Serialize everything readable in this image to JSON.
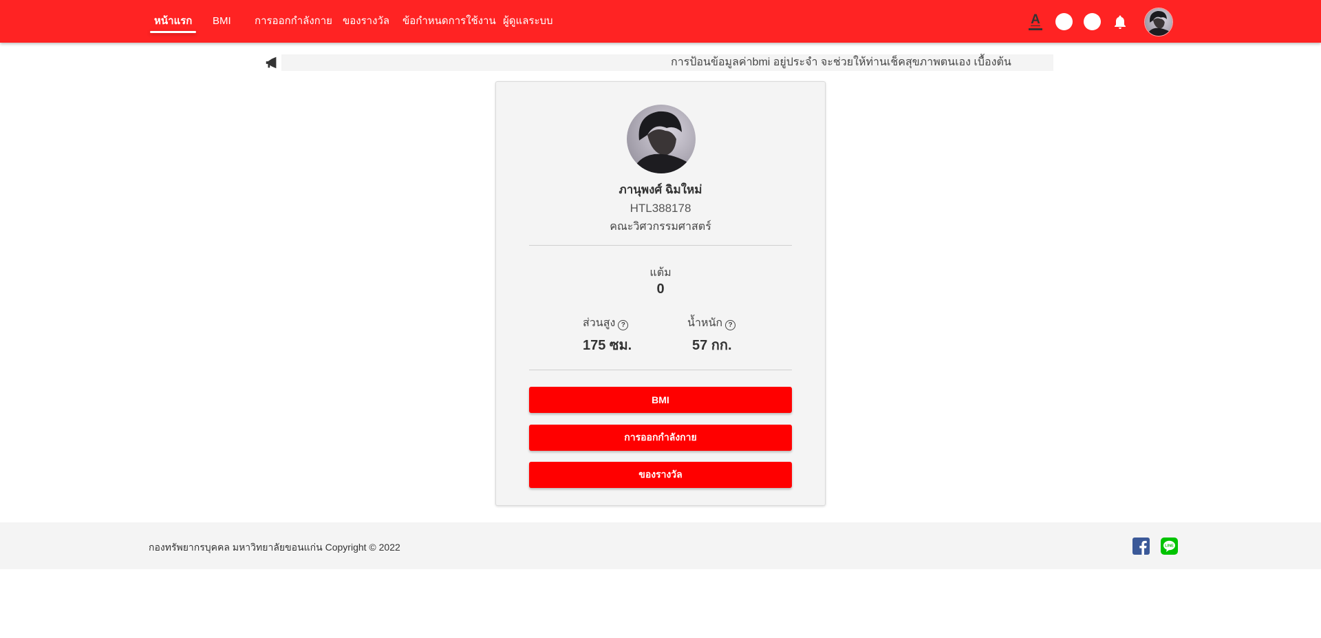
{
  "nav": {
    "items": [
      {
        "label": "หน้าแรก",
        "active": true
      },
      {
        "label": "BMI",
        "active": false
      },
      {
        "label": "การออกกำลังกาย",
        "active": false
      },
      {
        "label": "ของรางวัล",
        "active": false
      },
      {
        "label": "ข้อกำหนดการใช้งาน",
        "active": false
      },
      {
        "label": "ผู้ดูแลระบบ",
        "active": false
      }
    ],
    "font_size_icon": "A",
    "icons": [
      "font-size-icon",
      "theme-circle-icon",
      "theme-circle-icon",
      "bell-icon",
      "avatar"
    ]
  },
  "announcement": {
    "icon": "megaphone-icon",
    "text": "การป้อนข้อมูลค่าbmi อยู่ประจำ จะช่วยให้ท่านเช็คสุขภาพตนเอง เบื้องต้น"
  },
  "profile": {
    "name": "ภานุพงศ์ ฉิมใหม่",
    "id": "HTL388178",
    "faculty": "คณะวิศวกรรมศาสตร์",
    "points_label": "แต้ม",
    "points_value": "0",
    "height_label": "ส่วนสูง",
    "height_value": "175 ซม.",
    "weight_label": "น้ำหนัก",
    "weight_value": "57 กก.",
    "help_glyph": "?"
  },
  "buttons": {
    "bmi": "BMI",
    "exercise": "การออกกำลังกาย",
    "rewards": "ของรางวัล"
  },
  "footer": {
    "text": "กองทรัพยากรบุคคล มหาวิทยาลัยขอนแก่น Copyright © 2022",
    "social": [
      "facebook-icon",
      "line-icon"
    ]
  },
  "colors": {
    "brand_red": "#ff2323",
    "button_red": "#ff0000",
    "facebook": "#3b5998",
    "line": "#00c300",
    "card_bg": "#f4f4f4"
  }
}
